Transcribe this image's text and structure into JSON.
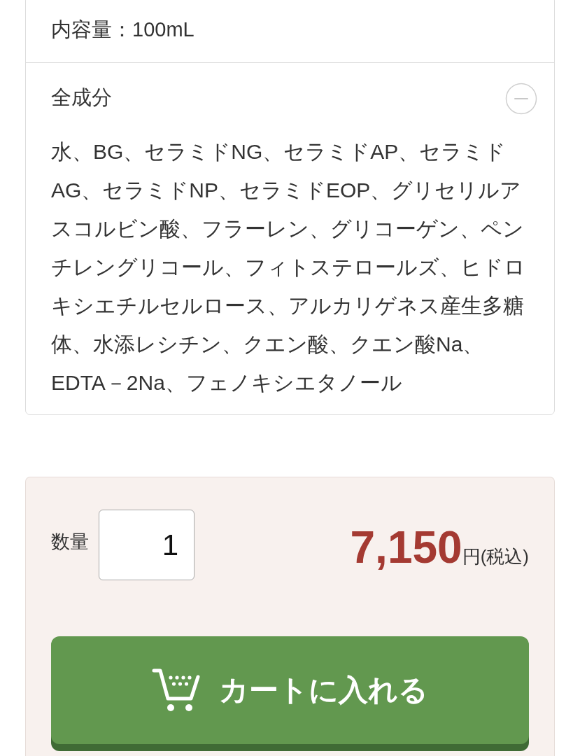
{
  "product_details": {
    "volume": "内容量：100mL",
    "ingredients": {
      "title": "全成分",
      "expanded": true,
      "text": "水、BG、セラミドNG、セラミドAP、セラミドAG、セラミドNP、セラミドEOP、グリセリルアスコルビン酸、フラーレン、グリコーゲン、ペンチレングリコール、フィトステロールズ、ヒドロキシエチルセルロース、アルカリゲネス産生多糖体、水添レシチン、クエン酸、クエン酸Na、EDTA－2Na、フェノキシエタノール"
    }
  },
  "purchase": {
    "quantity_label": "数量",
    "quantity": "1",
    "price": "7,150",
    "price_unit": "円(税込)",
    "cart_button": "カートに入れる"
  }
}
